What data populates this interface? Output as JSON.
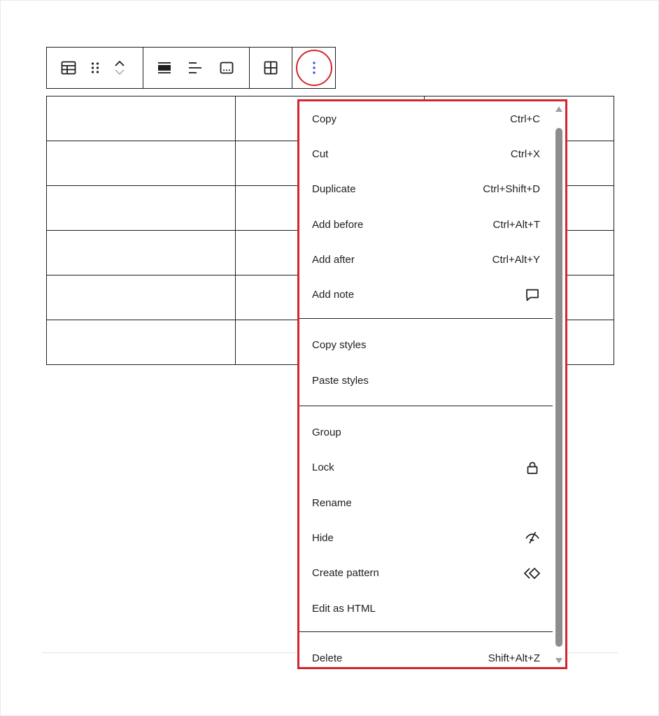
{
  "toolbar": {
    "icons": [
      "table-icon",
      "drag-handle-icon",
      "move-up-icon",
      "move-down-icon",
      "align-icon",
      "justify-left-icon",
      "caption-icon",
      "table-edit-icon",
      "more-options-icon"
    ]
  },
  "table": {
    "rows": 6,
    "cols": 3
  },
  "menu": {
    "sections": [
      [
        {
          "label": "Copy",
          "shortcut": "Ctrl+C"
        },
        {
          "label": "Cut",
          "shortcut": "Ctrl+X"
        },
        {
          "label": "Duplicate",
          "shortcut": "Ctrl+Shift+D"
        },
        {
          "label": "Add before",
          "shortcut": "Ctrl+Alt+T"
        },
        {
          "label": "Add after",
          "shortcut": "Ctrl+Alt+Y"
        },
        {
          "label": "Add note",
          "icon": "comment-icon"
        }
      ],
      [
        {
          "label": "Copy styles"
        },
        {
          "label": "Paste styles"
        }
      ],
      [
        {
          "label": "Group"
        },
        {
          "label": "Lock",
          "icon": "lock-icon"
        },
        {
          "label": "Rename"
        },
        {
          "label": "Hide",
          "icon": "hide-icon"
        },
        {
          "label": "Create pattern",
          "icon": "pattern-icon"
        },
        {
          "label": "Edit as HTML"
        }
      ],
      [
        {
          "label": "Delete",
          "shortcut": "Shift+Alt+Z"
        }
      ]
    ]
  },
  "colors": {
    "highlight": "#d3262b",
    "accent": "#3858e9",
    "text": "#1e1e1e"
  }
}
